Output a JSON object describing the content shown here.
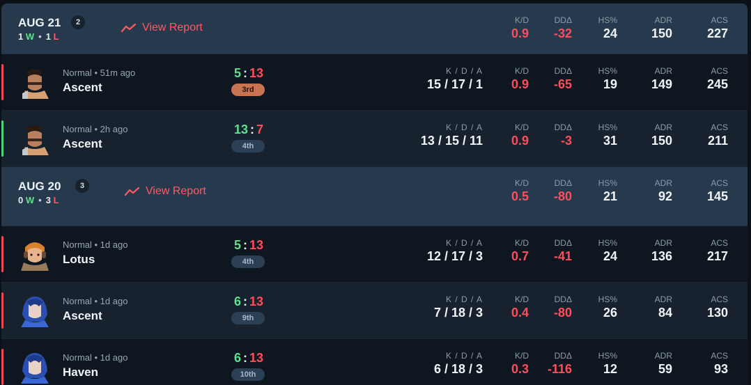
{
  "days": [
    {
      "date": "AUG 21",
      "count": "2",
      "wins": "1",
      "w_label": "W",
      "losses": "1",
      "l_label": "L",
      "report_label": "View Report",
      "stats": {
        "kd": "0.9",
        "dd": "-32",
        "hs": "24",
        "adr": "150",
        "acs": "227"
      },
      "matches": [
        {
          "mode": "Normal • 51m ago",
          "map": "Ascent",
          "score_a": "5",
          "score_b": "13",
          "place": "3rd",
          "result": "loss",
          "kda": "15 / 17 / 1",
          "kd": "0.9",
          "dd": "-65",
          "hs": "19",
          "adr": "149",
          "acs": "245"
        },
        {
          "mode": "Normal • 2h ago",
          "map": "Ascent",
          "score_a": "13",
          "score_b": "7",
          "place": "4th",
          "result": "win",
          "kda": "13 / 15 / 11",
          "kd": "0.9",
          "dd": "-3",
          "hs": "31",
          "adr": "150",
          "acs": "211"
        }
      ]
    },
    {
      "date": "AUG 20",
      "count": "3",
      "wins": "0",
      "w_label": "W",
      "losses": "3",
      "l_label": "L",
      "report_label": "View Report",
      "stats": {
        "kd": "0.5",
        "dd": "-80",
        "hs": "21",
        "adr": "92",
        "acs": "145"
      },
      "matches": [
        {
          "mode": "Normal • 1d ago",
          "map": "Lotus",
          "score_a": "5",
          "score_b": "13",
          "place": "4th",
          "result": "loss",
          "kda": "12 / 17 / 3",
          "kd": "0.7",
          "dd": "-41",
          "hs": "24",
          "adr": "136",
          "acs": "217"
        },
        {
          "mode": "Normal • 1d ago",
          "map": "Ascent",
          "score_a": "6",
          "score_b": "13",
          "place": "9th",
          "result": "loss",
          "kda": "7 / 18 / 3",
          "kd": "0.4",
          "dd": "-80",
          "hs": "26",
          "adr": "84",
          "acs": "130"
        },
        {
          "mode": "Normal • 1d ago",
          "map": "Haven",
          "score_a": "6",
          "score_b": "13",
          "place": "10th",
          "result": "loss",
          "kda": "6 / 18 / 3",
          "kd": "0.3",
          "dd": "-116",
          "hs": "12",
          "adr": "59",
          "acs": "93"
        }
      ]
    }
  ],
  "labels": {
    "kda": "K / D / A",
    "kd": "K/D",
    "dd": "DDΔ",
    "hs": "HS%",
    "adr": "ADR",
    "acs": "ACS"
  },
  "colors": {
    "win": "#5ee08c",
    "loss": "#ff4d5b",
    "accent": "#ff5a63",
    "header_bg": "#26394d"
  },
  "icons": {
    "report": "trend-line-icon"
  }
}
